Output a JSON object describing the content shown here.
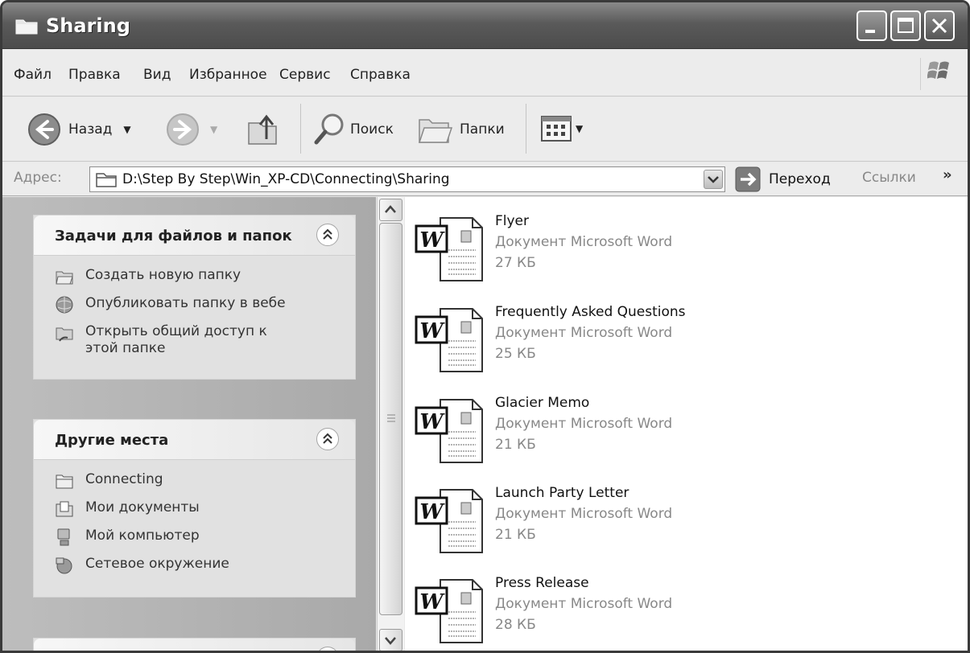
{
  "window": {
    "title": "Sharing"
  },
  "menu": [
    {
      "label": "Файл"
    },
    {
      "label": "Правка"
    },
    {
      "label": "Вид"
    },
    {
      "label": "Избранное"
    },
    {
      "label": "Сервис"
    },
    {
      "label": "Справка"
    }
  ],
  "toolbar": {
    "back_label": "Назад",
    "search_label": "Поиск",
    "folders_label": "Папки"
  },
  "address": {
    "label": "Адрес:",
    "path": "D:\\Step By Step\\Win_XP-CD\\Connecting\\Sharing",
    "go_label": "Переход",
    "links_label": "Ссылки",
    "more": "»"
  },
  "tasks_panel": {
    "title": "Задачи для файлов и папок",
    "items": [
      {
        "label": "Создать новую папку",
        "icon": "new-folder-icon"
      },
      {
        "label": "Опубликовать папку в вебе",
        "icon": "publish-web-icon"
      },
      {
        "label": "Открыть общий доступ к этой папке",
        "icon": "share-folder-icon"
      }
    ]
  },
  "places_panel": {
    "title": "Другие места",
    "items": [
      {
        "label": "Connecting",
        "icon": "folder-icon"
      },
      {
        "label": "Мои документы",
        "icon": "my-documents-icon"
      },
      {
        "label": "Мой компьютер",
        "icon": "my-computer-icon"
      },
      {
        "label": "Сетевое окружение",
        "icon": "network-places-icon"
      }
    ]
  },
  "files": [
    {
      "name": "Flyer",
      "type": "Документ Microsoft Word",
      "size": "27 КБ"
    },
    {
      "name": "Frequently Asked Questions",
      "type": "Документ Microsoft Word",
      "size": "25 КБ"
    },
    {
      "name": "Glacier Memo",
      "type": "Документ Microsoft Word",
      "size": "21 КБ"
    },
    {
      "name": "Launch Party Letter",
      "type": "Документ Microsoft Word",
      "size": "21 КБ"
    },
    {
      "name": "Press Release",
      "type": "Документ Microsoft Word",
      "size": "28 КБ"
    }
  ]
}
